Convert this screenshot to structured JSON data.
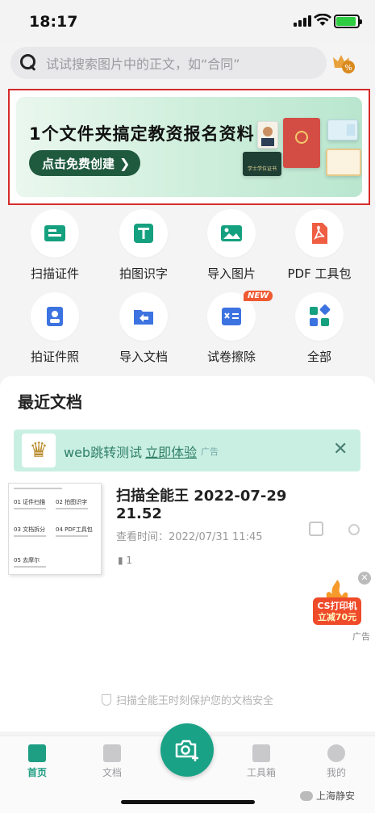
{
  "status_bar": {
    "time": "18:17"
  },
  "search": {
    "placeholder": "试试搜索图片中的正文，如“合同”"
  },
  "banner": {
    "title": "1个文件夹搞定教资报名资料",
    "cta": "点击免费创建",
    "certificate_text": "学士学位证书"
  },
  "tools": [
    {
      "label": "扫描证件",
      "icon": "id-card-icon"
    },
    {
      "label": "拍图识字",
      "icon": "text-recognition-icon"
    },
    {
      "label": "导入图片",
      "icon": "image-icon"
    },
    {
      "label": "PDF 工具包",
      "icon": "pdf-icon"
    },
    {
      "label": "拍证件照",
      "icon": "id-photo-icon"
    },
    {
      "label": "导入文档",
      "icon": "import-folder-icon"
    },
    {
      "label": "试卷擦除",
      "icon": "exam-erase-icon"
    },
    {
      "label": "全部",
      "icon": "all-apps-icon"
    }
  ],
  "new_badge": "NEW",
  "recent": {
    "heading": "最近文档",
    "ad": {
      "text": "web跳转测试",
      "link": "立即体验",
      "tag": "广告"
    },
    "document": {
      "name": "扫描全能王 2022-07-29 21.52",
      "viewed": "查看时间：2022/07/31 11:45",
      "pages": "1"
    }
  },
  "thumbnail_rows": [
    "01 证件扫描",
    "02 拍图识字",
    "03 文档拆分",
    "04 PDF工具包",
    "05 去摩尔"
  ],
  "promo": {
    "line1": "CS打印机",
    "line2": "立减70元",
    "tag": "广告"
  },
  "security_note": "扫描全能王时刻保护您的文档安全",
  "nav": [
    {
      "label": "首页",
      "active": true
    },
    {
      "label": "文档",
      "active": false
    },
    {
      "label": "工具箱",
      "active": false
    },
    {
      "label": "我的",
      "active": false
    }
  ],
  "watermark": "上海静安",
  "colors": {
    "brand": "#19a286",
    "banner_cta": "#1f5a3e",
    "highlight_border": "#d62b2b"
  }
}
